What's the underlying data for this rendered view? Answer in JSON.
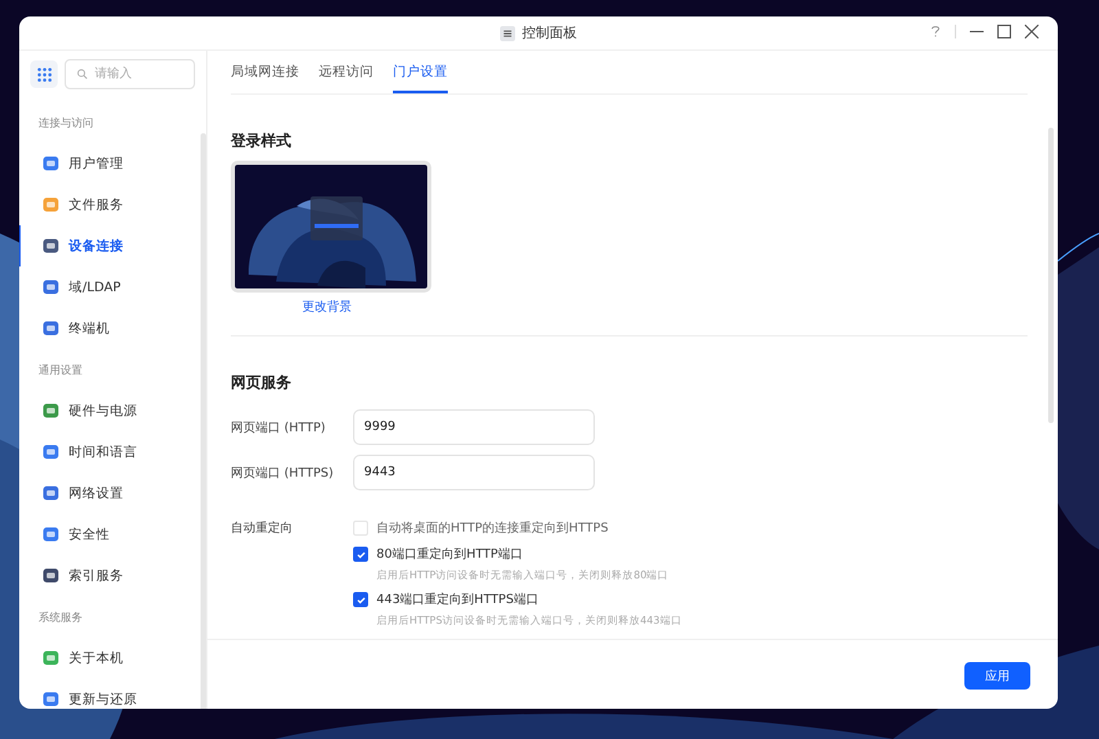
{
  "window": {
    "title": "控制面板"
  },
  "sidebar": {
    "search": {
      "placeholder": "请输入"
    },
    "groups": [
      {
        "label": "连接与访问",
        "items": [
          {
            "label": "用户管理",
            "selected": false
          },
          {
            "label": "文件服务",
            "selected": false
          },
          {
            "label": "设备连接",
            "selected": true
          },
          {
            "label": "域/LDAP",
            "selected": false
          },
          {
            "label": "终端机",
            "selected": false
          }
        ]
      },
      {
        "label": "通用设置",
        "items": [
          {
            "label": "硬件与电源",
            "selected": false
          },
          {
            "label": "时间和语言",
            "selected": false
          },
          {
            "label": "网络设置",
            "selected": false
          },
          {
            "label": "安全性",
            "selected": false
          },
          {
            "label": "索引服务",
            "selected": false
          }
        ]
      },
      {
        "label": "系统服务",
        "items": [
          {
            "label": "关于本机",
            "selected": false
          },
          {
            "label": "更新与还原",
            "selected": false
          }
        ]
      }
    ]
  },
  "tabs": [
    {
      "label": "局域网连接",
      "selected": false
    },
    {
      "label": "远程访问",
      "selected": false
    },
    {
      "label": "门户设置",
      "selected": true
    }
  ],
  "login_style": {
    "title": "登录样式",
    "link": "更改背景"
  },
  "web_service": {
    "title": "网页服务",
    "fields": [
      {
        "label": "网页端口 (HTTP)",
        "value": "9999"
      },
      {
        "label": "网页端口 (HTTPS)",
        "value": "9443"
      }
    ],
    "redirect": {
      "label": "自动重定向",
      "options": [
        {
          "label": "自动将桌面的HTTP的连接重定向到HTTPS",
          "checked": false,
          "disabled": true
        },
        {
          "label": "80端口重定向到HTTP端口",
          "checked": true,
          "disabled": false,
          "hint": "启用后HTTP访问设备时无需输入端口号，关闭则释放80端口"
        },
        {
          "label": "443端口重定向到HTTPS端口",
          "checked": true,
          "disabled": false,
          "hint": "启用后HTTPS访问设备时无需输入端口号，关闭则释放443端口"
        }
      ]
    }
  },
  "buttons": [
    "应用"
  ]
}
